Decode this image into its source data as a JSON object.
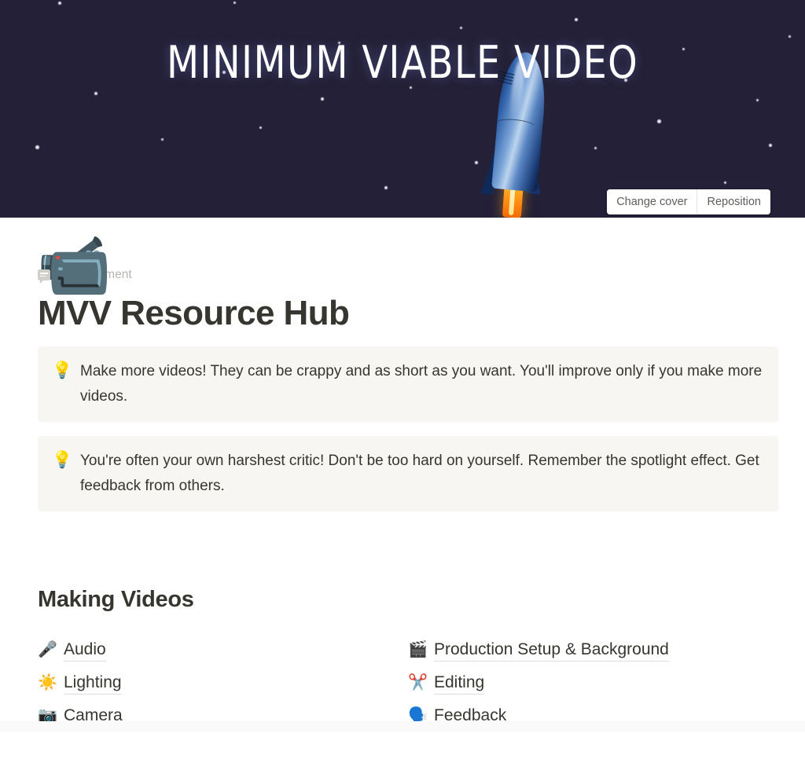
{
  "cover": {
    "title": "MINIMUM VIABLE VIDEO",
    "background_color": "#232037",
    "change_cover_label": "Change cover",
    "reposition_label": "Reposition",
    "illustration": "rocket-illustration"
  },
  "page": {
    "icon_emoji": "📹",
    "add_comment_label": "Add comment",
    "title": "MVV Resource Hub"
  },
  "callouts": [
    {
      "icon": "💡",
      "text": "Make more videos! They can be crappy and as short as you want. You'll improve only if you make more videos."
    },
    {
      "icon": "💡",
      "text": "You're often your own harshest critic! Don't be too hard on yourself. Remember the spotlight effect. Get feedback from others."
    }
  ],
  "section": {
    "heading": "Making Videos",
    "left_column": [
      {
        "icon": "🎤",
        "label": "Audio"
      },
      {
        "icon": "☀️",
        "label": "Lighting"
      },
      {
        "icon": "📷",
        "label": "Camera"
      }
    ],
    "right_column": [
      {
        "icon": "🎬",
        "label": "Production Setup & Background"
      },
      {
        "icon": "✂️",
        "label": "Editing"
      },
      {
        "icon": "🗣️",
        "label": "Feedback"
      }
    ]
  },
  "colors": {
    "cover_background": "#232037",
    "text": "#37352f",
    "callout_background": "#f7f6f3",
    "muted_text": "#b6b5b2",
    "underline": "#dedddb"
  }
}
